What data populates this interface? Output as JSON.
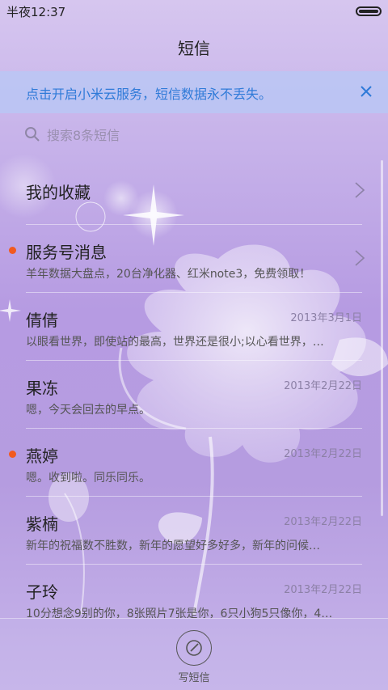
{
  "status_bar": {
    "time": "半夜12:37"
  },
  "header": {
    "title": "短信"
  },
  "banner": {
    "text": "点击开启小米云服务，短信数据永不丢失。",
    "close_icon": "close-icon"
  },
  "search": {
    "placeholder": "搜索8条短信",
    "icon": "search-icon"
  },
  "conversations": [
    {
      "name": "我的收藏",
      "preview": "",
      "date": "",
      "unread": false,
      "has_chevron": true
    },
    {
      "name": "服务号消息",
      "preview": "羊年数据大盘点，20台净化器、红米note3，免费领取！",
      "date": "",
      "unread": true,
      "has_chevron": true
    },
    {
      "name": "倩倩",
      "preview": "以眼看世界，即使站的最高，世界还是很小;以心看世界，…",
      "date": "2013年3月1日",
      "unread": false,
      "has_chevron": false
    },
    {
      "name": "果冻",
      "preview": "嗯，今天会回去的早点。",
      "date": "2013年2月22日",
      "unread": false,
      "has_chevron": false
    },
    {
      "name": "燕婷",
      "preview": "嗯。收到啦。同乐同乐。",
      "date": "2013年2月22日",
      "unread": true,
      "has_chevron": false
    },
    {
      "name": "紫楠",
      "preview": "新年的祝福数不胜数，新年的愿望好多好多，新年的问候…",
      "date": "2013年2月22日",
      "unread": false,
      "has_chevron": false
    },
    {
      "name": "子玲",
      "preview": "10分想念9别的你，8张照片7张是你，6只小狗5只像你，4…",
      "date": "2013年2月22日",
      "unread": false,
      "has_chevron": false
    }
  ],
  "compose": {
    "label": "写短信",
    "icon": "compose-pen-icon"
  },
  "colors": {
    "accent_blue": "#2f7ad8",
    "unread_dot": "#f25a1f",
    "background_purple": "#b69be2"
  }
}
